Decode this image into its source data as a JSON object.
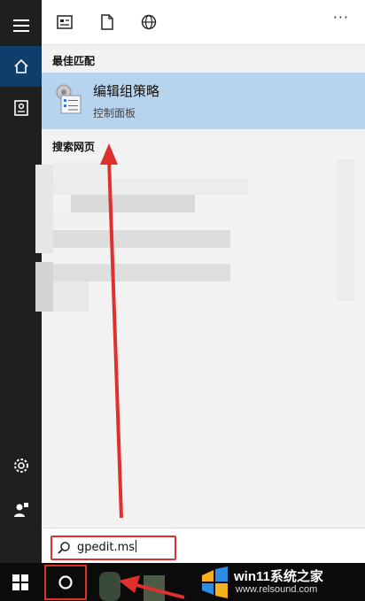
{
  "sidebar": {
    "items": [
      {
        "icon": "hamburger-menu-icon"
      },
      {
        "icon": "home-icon",
        "active": true
      },
      {
        "icon": "notebook-icon"
      },
      {
        "icon": "settings-gear-icon"
      },
      {
        "icon": "feedback-person-icon"
      }
    ]
  },
  "toolbar": {
    "icons": [
      "apps-filter-icon",
      "documents-filter-icon",
      "web-filter-icon"
    ],
    "more_label": "···"
  },
  "results": {
    "best_match_heading": "最佳匹配",
    "best_match": {
      "title": "编辑组策略",
      "subtitle": "控制面板",
      "icon": "group-policy-editor-icon"
    },
    "web_heading": "搜索网页",
    "web_results_note": "pixelated-hidden"
  },
  "search": {
    "value": "gpedit.ms",
    "icon": "search-magnifier-icon"
  },
  "taskbar": {
    "start_icon": "windows-start-icon",
    "cortana_icon": "cortana-circle-icon"
  },
  "watermark": {
    "name": "win11系统之家",
    "url": "www.relsound.com"
  },
  "colors": {
    "rail_bg": "#1f1f1f",
    "rail_active": "#0e3f6b",
    "best_match_highlight": "#b7d4ee",
    "annotation_red": "#e0302e"
  }
}
